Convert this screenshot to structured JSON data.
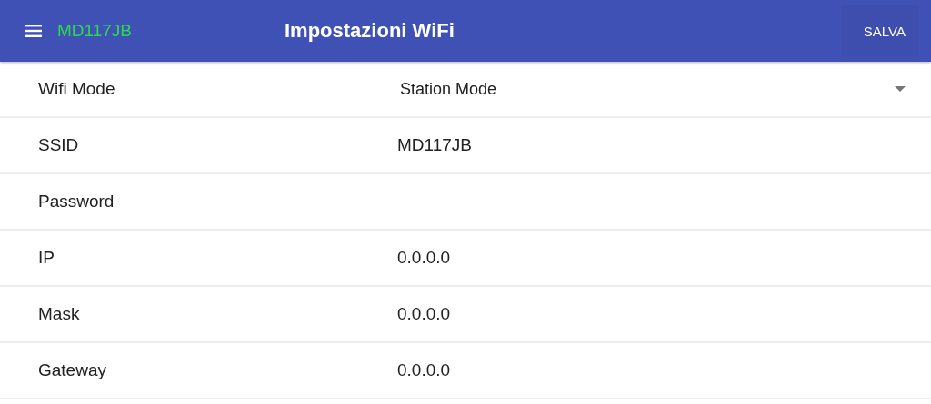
{
  "app_bar": {
    "device_name": "MD117JB",
    "title": "Impostazioni WiFi",
    "action": "SALVA"
  },
  "fields": [
    {
      "kind": "select",
      "label": "Wifi Mode",
      "value": "Station Mode"
    },
    {
      "kind": "input",
      "label": "SSID",
      "value": "MD117JB"
    },
    {
      "kind": "input",
      "label": "Password"
    },
    {
      "kind": "input",
      "label": "IP",
      "value": "0.0.0.0"
    },
    {
      "kind": "input",
      "label": "Mask",
      "value": "0.0.0.0"
    },
    {
      "kind": "input",
      "label": "Gateway",
      "value": "0.0.0.0"
    }
  ]
}
